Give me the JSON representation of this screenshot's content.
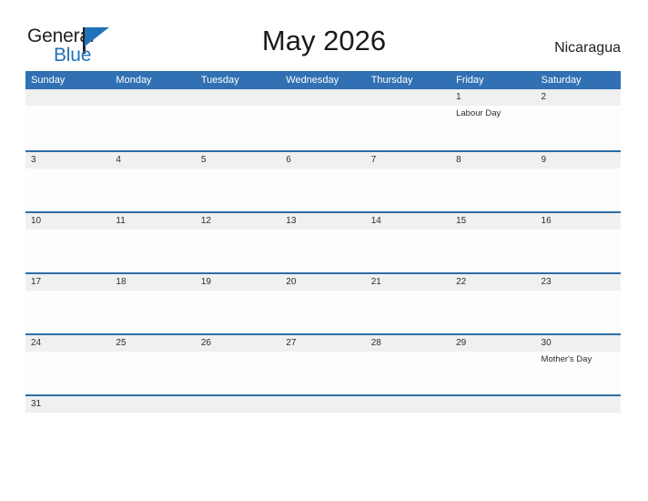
{
  "logo": {
    "word_one": "General",
    "word_two": "Blue",
    "flag_icon": "flag-triangle-icon",
    "brand_color": "#2272b9",
    "text_color": "#231f20"
  },
  "header": {
    "title": "May 2026",
    "country": "Nicaragua"
  },
  "theme": {
    "header_blue": "#3070b3",
    "rule_blue": "#2e6da4",
    "band_gray": "#f0f0f0",
    "text_color": "#2d2d2d"
  },
  "calendar": {
    "weekdays": [
      "Sunday",
      "Monday",
      "Tuesday",
      "Wednesday",
      "Thursday",
      "Friday",
      "Saturday"
    ],
    "weeks": [
      [
        {
          "date": "",
          "event": ""
        },
        {
          "date": "",
          "event": ""
        },
        {
          "date": "",
          "event": ""
        },
        {
          "date": "",
          "event": ""
        },
        {
          "date": "",
          "event": ""
        },
        {
          "date": "1",
          "event": "Labour Day"
        },
        {
          "date": "2",
          "event": ""
        }
      ],
      [
        {
          "date": "3",
          "event": ""
        },
        {
          "date": "4",
          "event": ""
        },
        {
          "date": "5",
          "event": ""
        },
        {
          "date": "6",
          "event": ""
        },
        {
          "date": "7",
          "event": ""
        },
        {
          "date": "8",
          "event": ""
        },
        {
          "date": "9",
          "event": ""
        }
      ],
      [
        {
          "date": "10",
          "event": ""
        },
        {
          "date": "11",
          "event": ""
        },
        {
          "date": "12",
          "event": ""
        },
        {
          "date": "13",
          "event": ""
        },
        {
          "date": "14",
          "event": ""
        },
        {
          "date": "15",
          "event": ""
        },
        {
          "date": "16",
          "event": ""
        }
      ],
      [
        {
          "date": "17",
          "event": ""
        },
        {
          "date": "18",
          "event": ""
        },
        {
          "date": "19",
          "event": ""
        },
        {
          "date": "20",
          "event": ""
        },
        {
          "date": "21",
          "event": ""
        },
        {
          "date": "22",
          "event": ""
        },
        {
          "date": "23",
          "event": ""
        }
      ],
      [
        {
          "date": "24",
          "event": ""
        },
        {
          "date": "25",
          "event": ""
        },
        {
          "date": "26",
          "event": ""
        },
        {
          "date": "27",
          "event": ""
        },
        {
          "date": "28",
          "event": ""
        },
        {
          "date": "29",
          "event": ""
        },
        {
          "date": "30",
          "event": "Mother's Day"
        }
      ],
      [
        {
          "date": "31",
          "event": ""
        },
        {
          "date": "",
          "event": ""
        },
        {
          "date": "",
          "event": ""
        },
        {
          "date": "",
          "event": ""
        },
        {
          "date": "",
          "event": ""
        },
        {
          "date": "",
          "event": ""
        },
        {
          "date": "",
          "event": ""
        }
      ]
    ]
  }
}
